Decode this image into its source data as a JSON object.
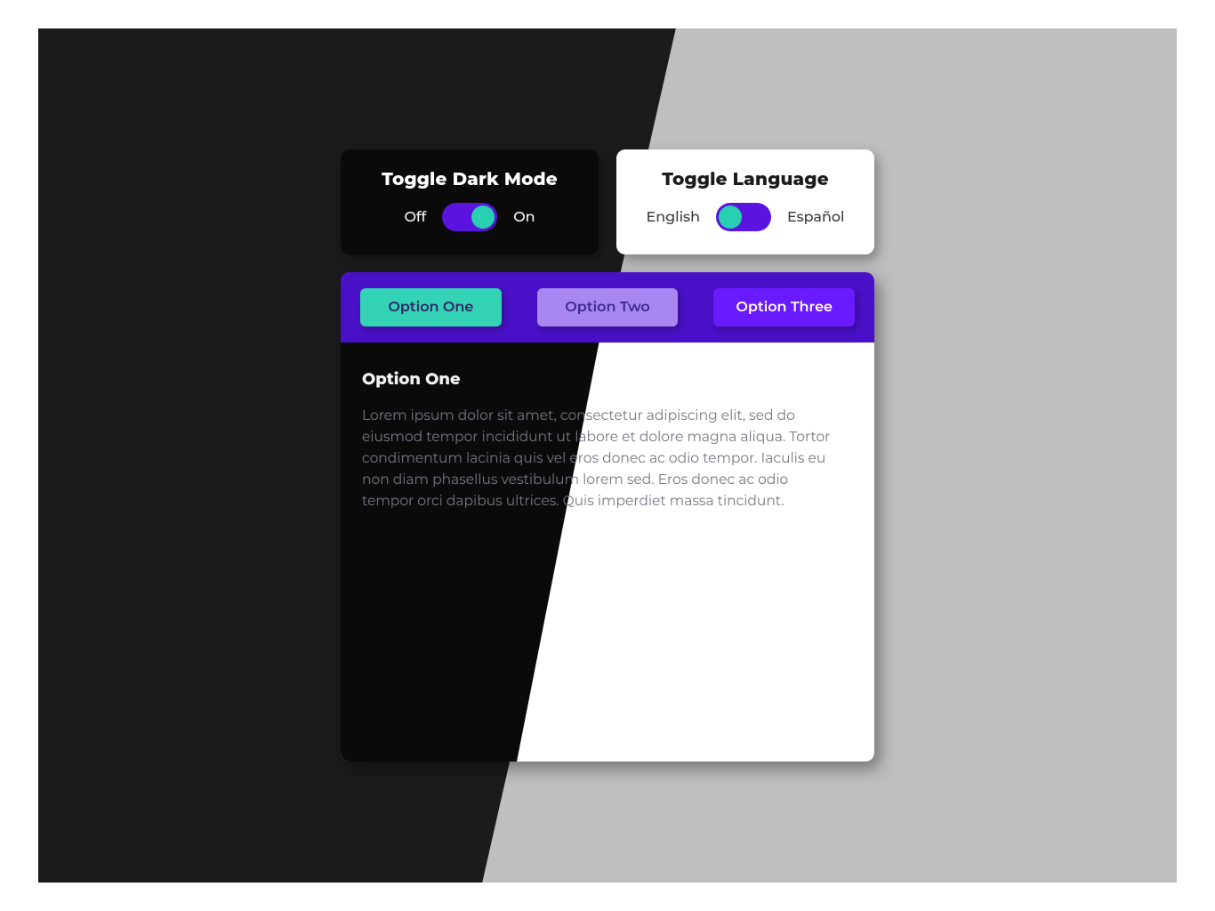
{
  "cards": {
    "dark_mode": {
      "title": "Toggle Dark Mode",
      "off_label": "Off",
      "on_label": "On",
      "state": "on"
    },
    "language": {
      "title": "Toggle Language",
      "left_label": "English",
      "right_label": "Español",
      "state": "off"
    }
  },
  "tabs": {
    "items": [
      {
        "label": "Option One"
      },
      {
        "label": "Option Two"
      },
      {
        "label": "Option Three"
      }
    ],
    "active_index": 0
  },
  "content": {
    "heading": "Option One",
    "body": "Lorem ipsum dolor sit amet, consectetur adipiscing elit, sed do eiusmod tempor incididunt ut labore et dolore magna aliqua. Tortor condimentum lacinia quis vel eros donec ac odio tempor. Iaculis eu non diam phasellus vestibulum lorem sed. Eros donec ac odio tempor orci dapibus ultrices. Quis imperdiet massa tincidunt."
  },
  "colors": {
    "accent_purple": "#5b14e0",
    "accent_teal": "#28cfb0",
    "tabbar_bg": "#4a10c8"
  }
}
